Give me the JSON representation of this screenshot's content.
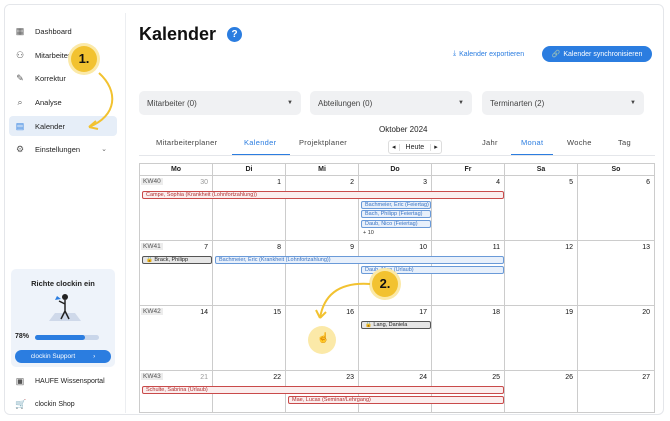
{
  "sidebar": {
    "items": [
      {
        "label": "Dashboard",
        "icon": "dashboard-icon"
      },
      {
        "label": "Mitarbeiter",
        "icon": "users-icon"
      },
      {
        "label": "Korrektur",
        "icon": "edit-icon"
      },
      {
        "label": "Analyse",
        "icon": "analysis-icon"
      },
      {
        "label": "Kalender",
        "icon": "calendar-icon"
      },
      {
        "label": "Einstellungen",
        "icon": "gear-icon"
      }
    ],
    "promo": {
      "title": "Richte clockin ein",
      "percent": "78%",
      "progress": 0.78,
      "button": "clockin Support"
    },
    "bottom": [
      {
        "label": "HAUFE Wissensportal",
        "icon": "book-icon"
      },
      {
        "label": "clockin Shop",
        "icon": "cart-icon"
      }
    ]
  },
  "header": {
    "title": "Kalender",
    "help": "?",
    "export_label": "Kalender exportieren",
    "sync_label": "Kalender synchronisieren"
  },
  "filters": [
    {
      "label": "Mitarbeiter (0)"
    },
    {
      "label": "Abteilungen (0)"
    },
    {
      "label": "Terminarten (2)"
    }
  ],
  "view_tabs": [
    "Mitarbeiterplaner",
    "Kalender",
    "Projektplaner"
  ],
  "range_tabs": [
    "Jahr",
    "Monat",
    "Woche",
    "Tag"
  ],
  "month_label": "Oktober 2024",
  "today_label": "Heute",
  "weekdays": [
    "Mo",
    "Di",
    "Mi",
    "Do",
    "Fr",
    "Sa",
    "So"
  ],
  "weeks": [
    {
      "kw": "KW40",
      "days": [
        "30",
        "1",
        "2",
        "3",
        "4",
        "5",
        "6"
      ]
    },
    {
      "kw": "KW41",
      "days": [
        "7",
        "8",
        "9",
        "10",
        "11",
        "12",
        "13"
      ]
    },
    {
      "kw": "KW42",
      "days": [
        "14",
        "15",
        "16",
        "17",
        "18",
        "19",
        "20"
      ]
    },
    {
      "kw": "KW43",
      "days": [
        "21",
        "22",
        "23",
        "24",
        "25",
        "26",
        "27"
      ]
    }
  ],
  "events": {
    "campe": "Campe, Sophia (Krankheit (Lohnfortzahlung))",
    "bachmeier1": "Bachmeier, Eric (Feiertag)",
    "bachmeier2": "Bach, Philipp (Feiertag)",
    "daub1": "Daub, Nico (Feiertag)",
    "more": "+ 10",
    "brack": "Brack, Philipp",
    "bachmeier_krank": "Bachmeier, Eric (Krankheit (Lohnfortzahlung))",
    "daub_urlaub": "Daub, Nico (Urlaub)",
    "lang": "Lang, Daniela",
    "schulte": "Schulte, Sabrina (Urlaub)",
    "mae": "Mae, Lucas (Seminar/Lehrgang)"
  },
  "annotations": {
    "one": "1.",
    "two": "2."
  }
}
